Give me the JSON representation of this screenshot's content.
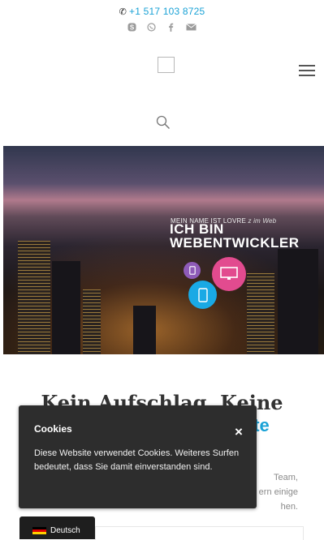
{
  "header": {
    "phone": "+1 517 103 8725",
    "social_icons": [
      "skype-icon",
      "whatsapp-icon",
      "facebook-icon",
      "mail-icon"
    ]
  },
  "hero": {
    "tagline": "MEIN NAME IST LOVRE",
    "tagline_suffix": "z im Web",
    "title_line1": "ICH BIN",
    "title_line2": "WEBENTWICKLER",
    "device_colors": {
      "tablet": "#8e5bb8",
      "monitor": "#e24b8f",
      "phone": "#19a9e5"
    }
  },
  "section": {
    "title_line1": "Kein Aufschlag, Keine",
    "title_line2": "ste",
    "body_fragments": [
      "Team,",
      "ern einige",
      "hen."
    ]
  },
  "cookie_banner": {
    "title": "Cookies",
    "text": "Diese Website verwendet Cookies. Weiteres Surfen bedeutet, dass Sie damit einverstanden sind.",
    "close": "×"
  },
  "language": {
    "label": "Deutsch",
    "flag_colors": [
      "#000000",
      "#dd0000",
      "#ffce00"
    ]
  },
  "colors": {
    "accent": "#1aa2d6",
    "banner_bg": "#2d2d2d"
  }
}
